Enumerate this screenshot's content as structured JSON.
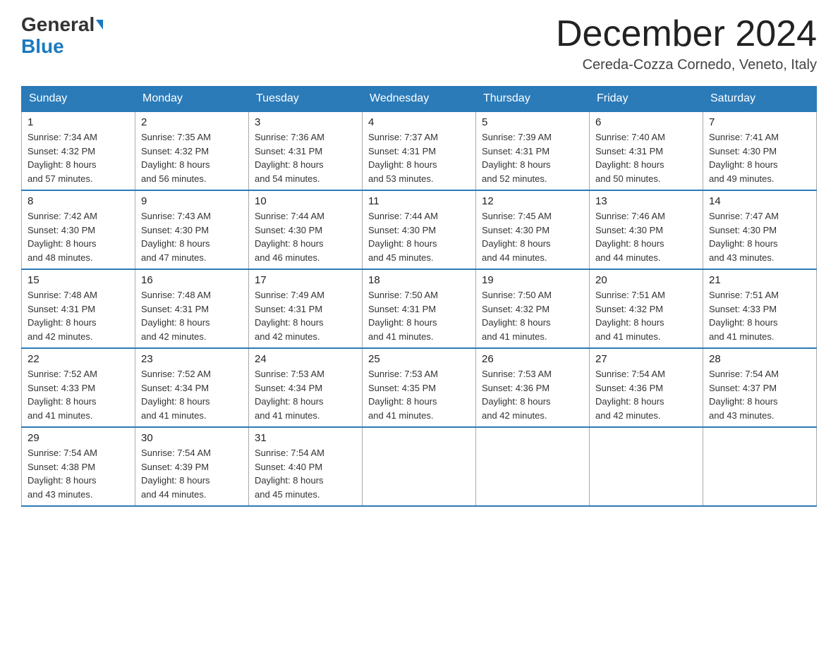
{
  "header": {
    "logo_general": "General",
    "logo_blue": "Blue",
    "month_title": "December 2024",
    "location": "Cereda-Cozza Cornedo, Veneto, Italy"
  },
  "days_of_week": [
    "Sunday",
    "Monday",
    "Tuesday",
    "Wednesday",
    "Thursday",
    "Friday",
    "Saturday"
  ],
  "weeks": [
    [
      {
        "day": "1",
        "sunrise": "7:34 AM",
        "sunset": "4:32 PM",
        "daylight": "8 hours and 57 minutes."
      },
      {
        "day": "2",
        "sunrise": "7:35 AM",
        "sunset": "4:32 PM",
        "daylight": "8 hours and 56 minutes."
      },
      {
        "day": "3",
        "sunrise": "7:36 AM",
        "sunset": "4:31 PM",
        "daylight": "8 hours and 54 minutes."
      },
      {
        "day": "4",
        "sunrise": "7:37 AM",
        "sunset": "4:31 PM",
        "daylight": "8 hours and 53 minutes."
      },
      {
        "day": "5",
        "sunrise": "7:39 AM",
        "sunset": "4:31 PM",
        "daylight": "8 hours and 52 minutes."
      },
      {
        "day": "6",
        "sunrise": "7:40 AM",
        "sunset": "4:31 PM",
        "daylight": "8 hours and 50 minutes."
      },
      {
        "day": "7",
        "sunrise": "7:41 AM",
        "sunset": "4:30 PM",
        "daylight": "8 hours and 49 minutes."
      }
    ],
    [
      {
        "day": "8",
        "sunrise": "7:42 AM",
        "sunset": "4:30 PM",
        "daylight": "8 hours and 48 minutes."
      },
      {
        "day": "9",
        "sunrise": "7:43 AM",
        "sunset": "4:30 PM",
        "daylight": "8 hours and 47 minutes."
      },
      {
        "day": "10",
        "sunrise": "7:44 AM",
        "sunset": "4:30 PM",
        "daylight": "8 hours and 46 minutes."
      },
      {
        "day": "11",
        "sunrise": "7:44 AM",
        "sunset": "4:30 PM",
        "daylight": "8 hours and 45 minutes."
      },
      {
        "day": "12",
        "sunrise": "7:45 AM",
        "sunset": "4:30 PM",
        "daylight": "8 hours and 44 minutes."
      },
      {
        "day": "13",
        "sunrise": "7:46 AM",
        "sunset": "4:30 PM",
        "daylight": "8 hours and 44 minutes."
      },
      {
        "day": "14",
        "sunrise": "7:47 AM",
        "sunset": "4:30 PM",
        "daylight": "8 hours and 43 minutes."
      }
    ],
    [
      {
        "day": "15",
        "sunrise": "7:48 AM",
        "sunset": "4:31 PM",
        "daylight": "8 hours and 42 minutes."
      },
      {
        "day": "16",
        "sunrise": "7:48 AM",
        "sunset": "4:31 PM",
        "daylight": "8 hours and 42 minutes."
      },
      {
        "day": "17",
        "sunrise": "7:49 AM",
        "sunset": "4:31 PM",
        "daylight": "8 hours and 42 minutes."
      },
      {
        "day": "18",
        "sunrise": "7:50 AM",
        "sunset": "4:31 PM",
        "daylight": "8 hours and 41 minutes."
      },
      {
        "day": "19",
        "sunrise": "7:50 AM",
        "sunset": "4:32 PM",
        "daylight": "8 hours and 41 minutes."
      },
      {
        "day": "20",
        "sunrise": "7:51 AM",
        "sunset": "4:32 PM",
        "daylight": "8 hours and 41 minutes."
      },
      {
        "day": "21",
        "sunrise": "7:51 AM",
        "sunset": "4:33 PM",
        "daylight": "8 hours and 41 minutes."
      }
    ],
    [
      {
        "day": "22",
        "sunrise": "7:52 AM",
        "sunset": "4:33 PM",
        "daylight": "8 hours and 41 minutes."
      },
      {
        "day": "23",
        "sunrise": "7:52 AM",
        "sunset": "4:34 PM",
        "daylight": "8 hours and 41 minutes."
      },
      {
        "day": "24",
        "sunrise": "7:53 AM",
        "sunset": "4:34 PM",
        "daylight": "8 hours and 41 minutes."
      },
      {
        "day": "25",
        "sunrise": "7:53 AM",
        "sunset": "4:35 PM",
        "daylight": "8 hours and 41 minutes."
      },
      {
        "day": "26",
        "sunrise": "7:53 AM",
        "sunset": "4:36 PM",
        "daylight": "8 hours and 42 minutes."
      },
      {
        "day": "27",
        "sunrise": "7:54 AM",
        "sunset": "4:36 PM",
        "daylight": "8 hours and 42 minutes."
      },
      {
        "day": "28",
        "sunrise": "7:54 AM",
        "sunset": "4:37 PM",
        "daylight": "8 hours and 43 minutes."
      }
    ],
    [
      {
        "day": "29",
        "sunrise": "7:54 AM",
        "sunset": "4:38 PM",
        "daylight": "8 hours and 43 minutes."
      },
      {
        "day": "30",
        "sunrise": "7:54 AM",
        "sunset": "4:39 PM",
        "daylight": "8 hours and 44 minutes."
      },
      {
        "day": "31",
        "sunrise": "7:54 AM",
        "sunset": "4:40 PM",
        "daylight": "8 hours and 45 minutes."
      },
      null,
      null,
      null,
      null
    ]
  ],
  "labels": {
    "sunrise": "Sunrise:",
    "sunset": "Sunset:",
    "daylight": "Daylight:"
  }
}
